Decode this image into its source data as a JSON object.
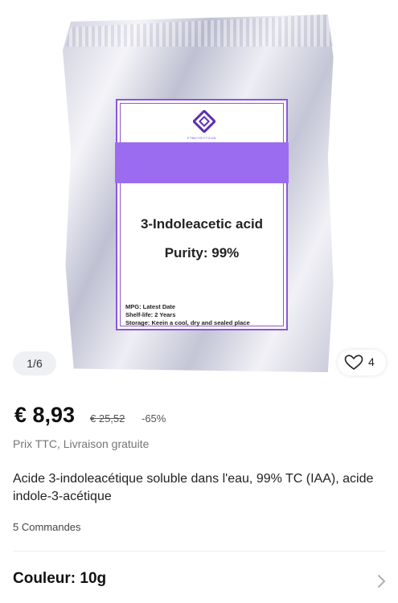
{
  "gallery": {
    "counter": "1/6",
    "likes": "4",
    "image": {
      "brand": "FTMCYEYTCUN",
      "product_name": "3-Indoleacetic acid",
      "purity": "Purity: 99%",
      "details": [
        "MPG: Latest Date",
        "Shelf-life: 2 Years",
        "Storage: Keein a cool,  dry and sealed place"
      ]
    }
  },
  "price": {
    "current": "€ 8,93",
    "original": "€ 25,52",
    "discount": "-65%"
  },
  "shipping_note": "Prix TTC, Livraison gratuite",
  "title": "Acide 3-indoleacétique soluble dans l'eau, 99% TC (IAA), acide indole-3-acétique",
  "orders": "5 Commandes",
  "variant": {
    "label": "Couleur: 10g"
  },
  "colors": {
    "label_border": "#8a57d8",
    "label_band": "#9b6cf0",
    "text_primary": "#111111",
    "text_muted": "#757575"
  }
}
